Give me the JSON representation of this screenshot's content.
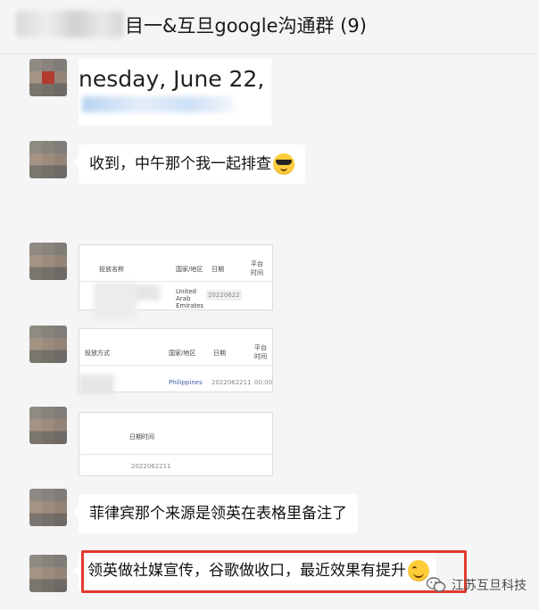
{
  "header": {
    "title": "目一&互旦google沟通群 (9)"
  },
  "messages": {
    "m1": {
      "text": "nesday, June 22, 2"
    },
    "m2": {
      "text": "收到，中午那个我一起排查",
      "emoji": "sunglasses-emoji"
    },
    "m3": {
      "cols": [
        "投放名称",
        "国家/地区",
        "日期",
        "平台时间"
      ],
      "country": "United Arab Emirates",
      "date": "20220622"
    },
    "m4": {
      "cols": [
        "投放方式",
        "国家/地区",
        "日期",
        "平台时间"
      ],
      "country": "Philippines",
      "date": "2022062211",
      "time": "00:00"
    },
    "m5": {
      "col": "日期时间",
      "date": "2022062211"
    },
    "m6": {
      "text": "菲律宾那个来源是领英在表格里备注了"
    },
    "m7": {
      "text": "领英做社媒宣传，谷歌做收口，最近效果有提升",
      "emoji": "smiling-emoji"
    }
  },
  "watermark": {
    "text": "江苏互旦科技"
  },
  "colors": {
    "background": "#f5f5f5",
    "bubble": "#ffffff",
    "highlight": "#e23a2f"
  }
}
